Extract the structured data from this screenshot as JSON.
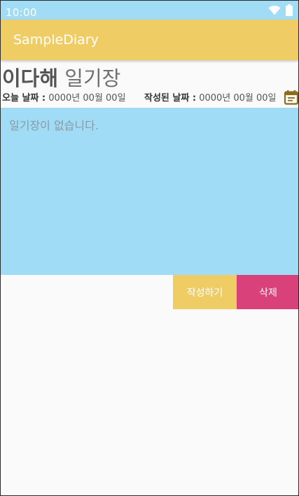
{
  "status_bar": {
    "time": "10:00",
    "icons": [
      "wifi-icon",
      "battery-icon"
    ]
  },
  "app_bar": {
    "title": "SampleDiary"
  },
  "header": {
    "owner": "이다해",
    "title_suffix": " 일기장"
  },
  "dates": {
    "today_label": "오늘 날짜 :",
    "today_value": " 0000년 00월 00일",
    "written_label": "작성된 날짜 :",
    "written_value": " 0000년 00월 00일",
    "calendar_icon": "calendar-icon"
  },
  "diary": {
    "placeholder": "일기장이 없습니다.",
    "value": ""
  },
  "actions": {
    "write_label": "작성하기",
    "delete_label": "삭제"
  },
  "colors": {
    "status_bar": "#a0dcf6",
    "app_bar": "#f0cd64",
    "diary_area": "#a0dcf6",
    "write_button": "#f0cd64",
    "delete_button": "#d8417a",
    "calendar_icon": "#8a6d1a"
  }
}
